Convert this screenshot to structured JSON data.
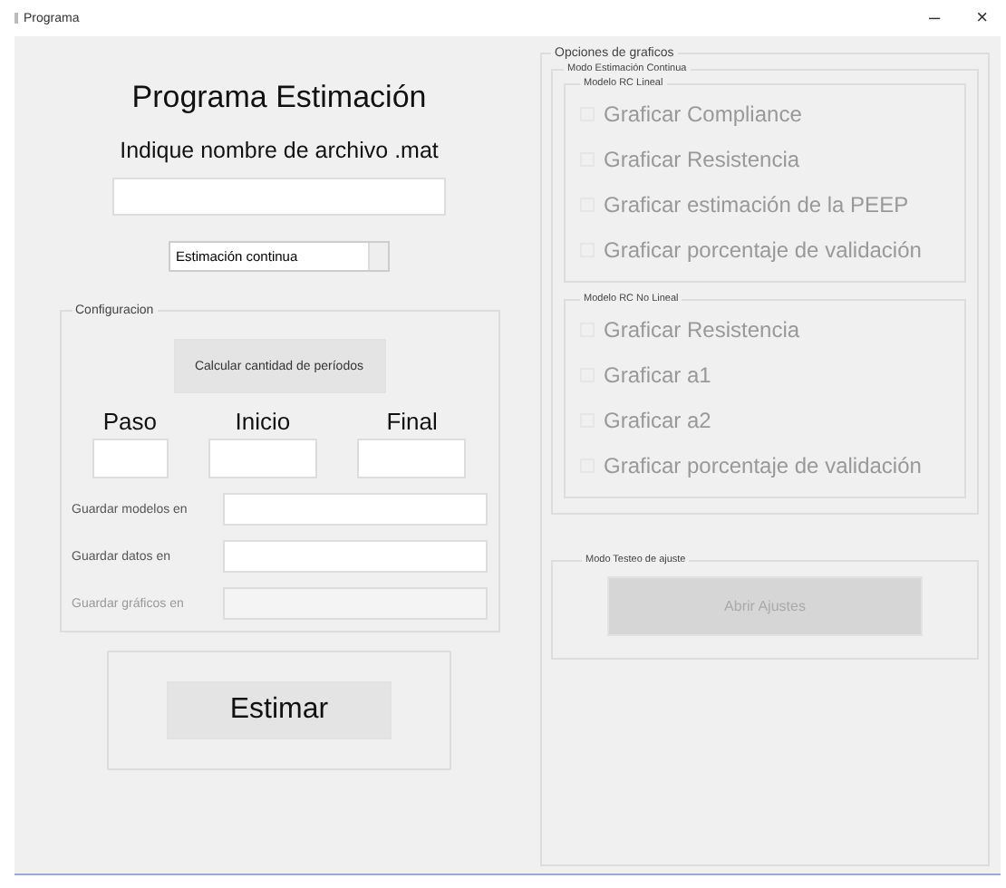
{
  "window": {
    "title": "Programa",
    "controls": [
      "–",
      "×"
    ]
  },
  "left": {
    "heading": "Programa Estimación",
    "file_label": "Indique nombre de archivo .mat",
    "mode_select": {
      "value": "Estimación continua"
    },
    "config": {
      "title": "Configuracion",
      "calc_button": "Calcular cantidad de períodos",
      "ranges": [
        {
          "label": "Paso"
        },
        {
          "label": "Inicio"
        },
        {
          "label": "Final"
        }
      ],
      "paths": [
        {
          "label": "Guardar modelos en",
          "disabled": false
        },
        {
          "label": "Guardar datos en",
          "disabled": false
        },
        {
          "label": "Guardar gráficos en",
          "disabled": true
        }
      ]
    },
    "estimate_button": "Estimar"
  },
  "right": {
    "title": "Opciones de graficos",
    "continuous": {
      "title": "Modo Estimación Continua",
      "groups": [
        {
          "title": "Modelo RC Lineal",
          "options": [
            {
              "label": "Graficar Compliance",
              "checked": false,
              "disabled": true
            },
            {
              "label": "Graficar Resistencia",
              "checked": false,
              "disabled": true
            },
            {
              "label": "Graficar estimación de la PEEP",
              "checked": false,
              "disabled": true
            },
            {
              "label": "Graficar porcentaje de validación",
              "checked": false,
              "disabled": true
            }
          ]
        },
        {
          "title": "Modelo RC No Lineal",
          "options": [
            {
              "label": "Graficar Resistencia",
              "checked": false,
              "disabled": true
            },
            {
              "label": "Graficar a1",
              "checked": false,
              "disabled": true
            },
            {
              "label": "Graficar a2",
              "checked": false,
              "disabled": true
            },
            {
              "label": "Graficar porcentaje de validación",
              "checked": false,
              "disabled": true
            }
          ]
        }
      ]
    },
    "test": {
      "title": "Modo Testeo de ajuste",
      "button": {
        "label": "Abrir Ajustes",
        "disabled": true
      }
    }
  }
}
